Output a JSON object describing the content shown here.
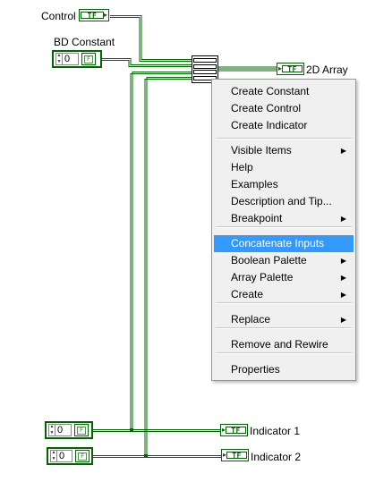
{
  "diagram": {
    "control_label": "Control",
    "bd_constant_label": "BD Constant",
    "output_label": "2D Array",
    "indicator1_label": "Indicator 1",
    "indicator2_label": "Indicator 2",
    "tf_text": "TF",
    "index_value": "0",
    "bool_element": "F",
    "wire_color": "#006600"
  },
  "menu": {
    "items": [
      {
        "label": "Create Constant"
      },
      {
        "label": "Create Control"
      },
      {
        "label": "Create Indicator"
      },
      {
        "label": "Visible Items",
        "submenu": true
      },
      {
        "label": "Help"
      },
      {
        "label": "Examples"
      },
      {
        "label": "Description and Tip..."
      },
      {
        "label": "Breakpoint",
        "submenu": true
      },
      {
        "label": "Concatenate Inputs",
        "highlighted": true
      },
      {
        "label": "Boolean Palette",
        "submenu": true
      },
      {
        "label": "Array Palette",
        "submenu": true
      },
      {
        "label": "Create",
        "submenu": true
      },
      {
        "label": "Replace",
        "submenu": true
      },
      {
        "label": "Remove and Rewire"
      },
      {
        "label": "Properties"
      }
    ],
    "highlight_color": "#3399ff"
  }
}
